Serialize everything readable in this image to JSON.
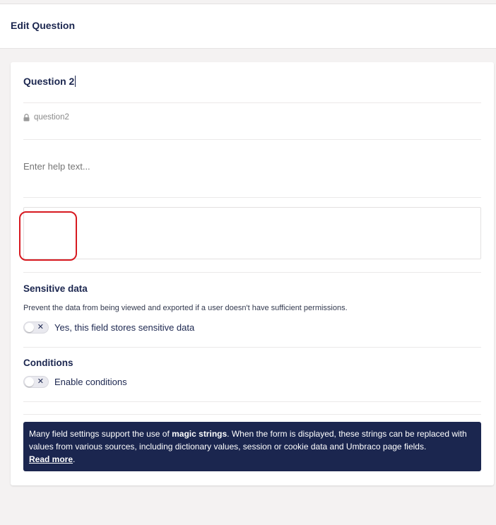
{
  "header": {
    "title": "Edit Question"
  },
  "field": {
    "caption": "Question 2",
    "alias": "question2",
    "help_placeholder": "Enter help text..."
  },
  "sensitive": {
    "heading": "Sensitive data",
    "description": "Prevent the data from being viewed and exported if a user doesn't have sufficient permissions.",
    "toggle_label": "Yes, this field stores sensitive data",
    "enabled": false
  },
  "conditions": {
    "heading": "Conditions",
    "toggle_label": "Enable conditions",
    "enabled": false
  },
  "info": {
    "text_before": "Many field settings support the use of ",
    "highlight": "magic strings",
    "text_after": ". When the form is displayed, these strings can be replaced with values from various sources, including dictionary values, session or cookie data and Umbraco page fields.",
    "link": "Read more",
    "link_suffix": "."
  },
  "colors": {
    "accent": "#1b264f",
    "highlight_border": "#d71920",
    "background": "#f4f2f2"
  },
  "icons": {
    "alias_lock": "lock-icon",
    "toggle_off": "close-icon"
  }
}
